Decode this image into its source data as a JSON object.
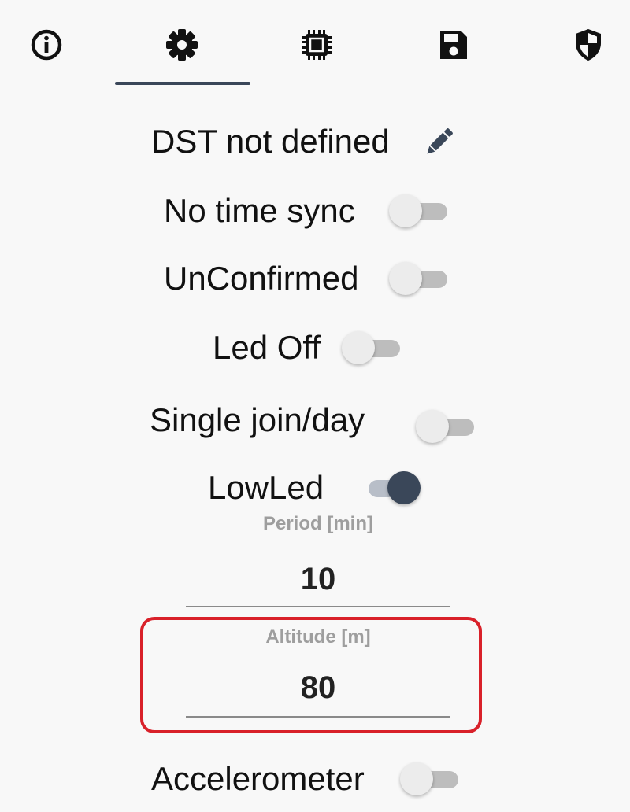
{
  "tabs": [
    {
      "name": "info",
      "icon": "info-icon",
      "active": false
    },
    {
      "name": "settings",
      "icon": "gear-icon",
      "active": true
    },
    {
      "name": "hardware",
      "icon": "chip-icon",
      "active": false
    },
    {
      "name": "save",
      "icon": "save-icon",
      "active": false
    },
    {
      "name": "security",
      "icon": "shield-icon",
      "active": false
    }
  ],
  "settings": {
    "dst_label": "DST not defined",
    "time_sync_label": "No time sync",
    "time_sync_on": false,
    "unconfirmed_label": "UnConfirmed",
    "unconfirmed_on": false,
    "led_off_label": "Led Off",
    "led_off_on": false,
    "single_join_label": "Single join/day",
    "single_join_on": false,
    "lowled_label": "LowLed",
    "lowled_on": true,
    "period_label": "Period [min]",
    "period_value": "10",
    "altitude_label": "Altitude [m]",
    "altitude_value": "80",
    "accelerometer_label": "Accelerometer",
    "accelerometer_on": false
  },
  "colors": {
    "accent": "#3a4759",
    "highlight_border": "#d9212a",
    "background": "#f8f8f8"
  }
}
